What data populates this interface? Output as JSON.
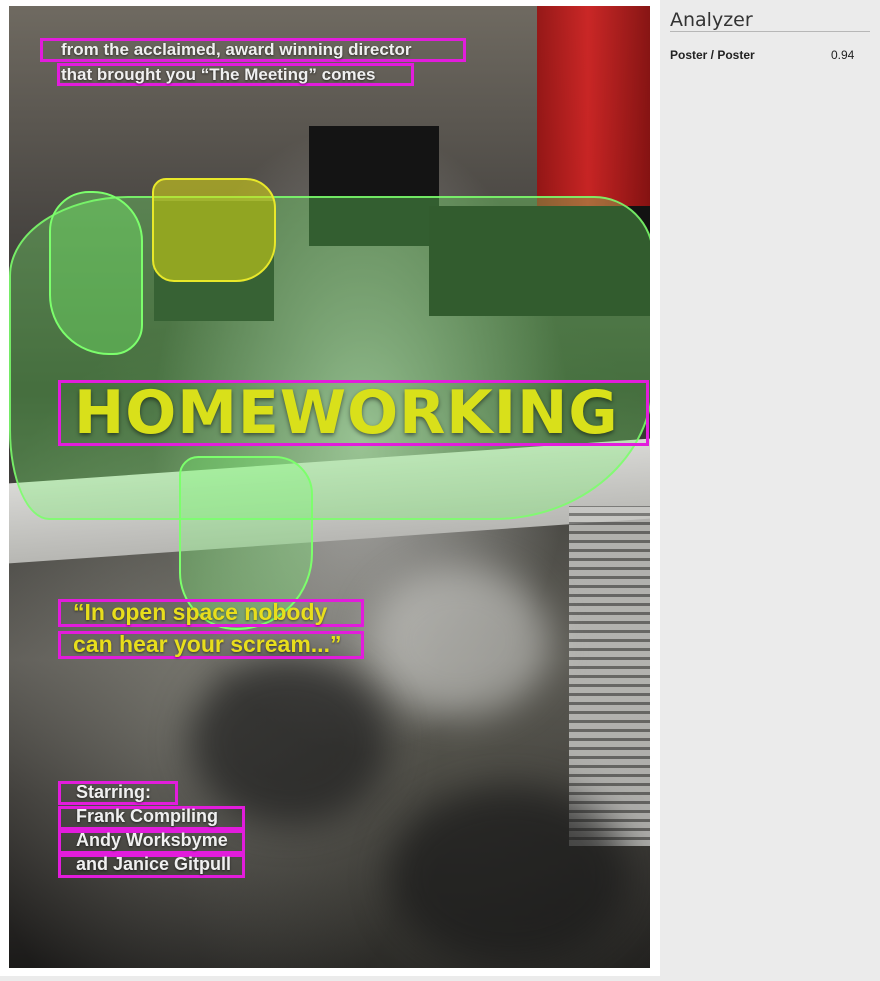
{
  "poster": {
    "tagline_line1": "from the acclaimed, award winning director",
    "tagline_line2": "that brought you “The Meeting” comes",
    "title": "HOMEWORKING",
    "quote_line1": "“In open space nobody",
    "quote_line2": "can hear your scream...”",
    "starring_label": "Starring:",
    "actor1": "Frank Compiling",
    "actor2": "Andy Worksbyme",
    "actor3": "and Janice Gitpull"
  },
  "analyzer": {
    "title": "Analyzer",
    "result_label": "Poster / Poster",
    "result_score": "0.94"
  },
  "colors": {
    "box": "#e21cdc",
    "mask_green": "#7cff6c",
    "mask_yellow": "#e8e82a",
    "title": "#d9e01a",
    "quote": "#e8de1c"
  }
}
